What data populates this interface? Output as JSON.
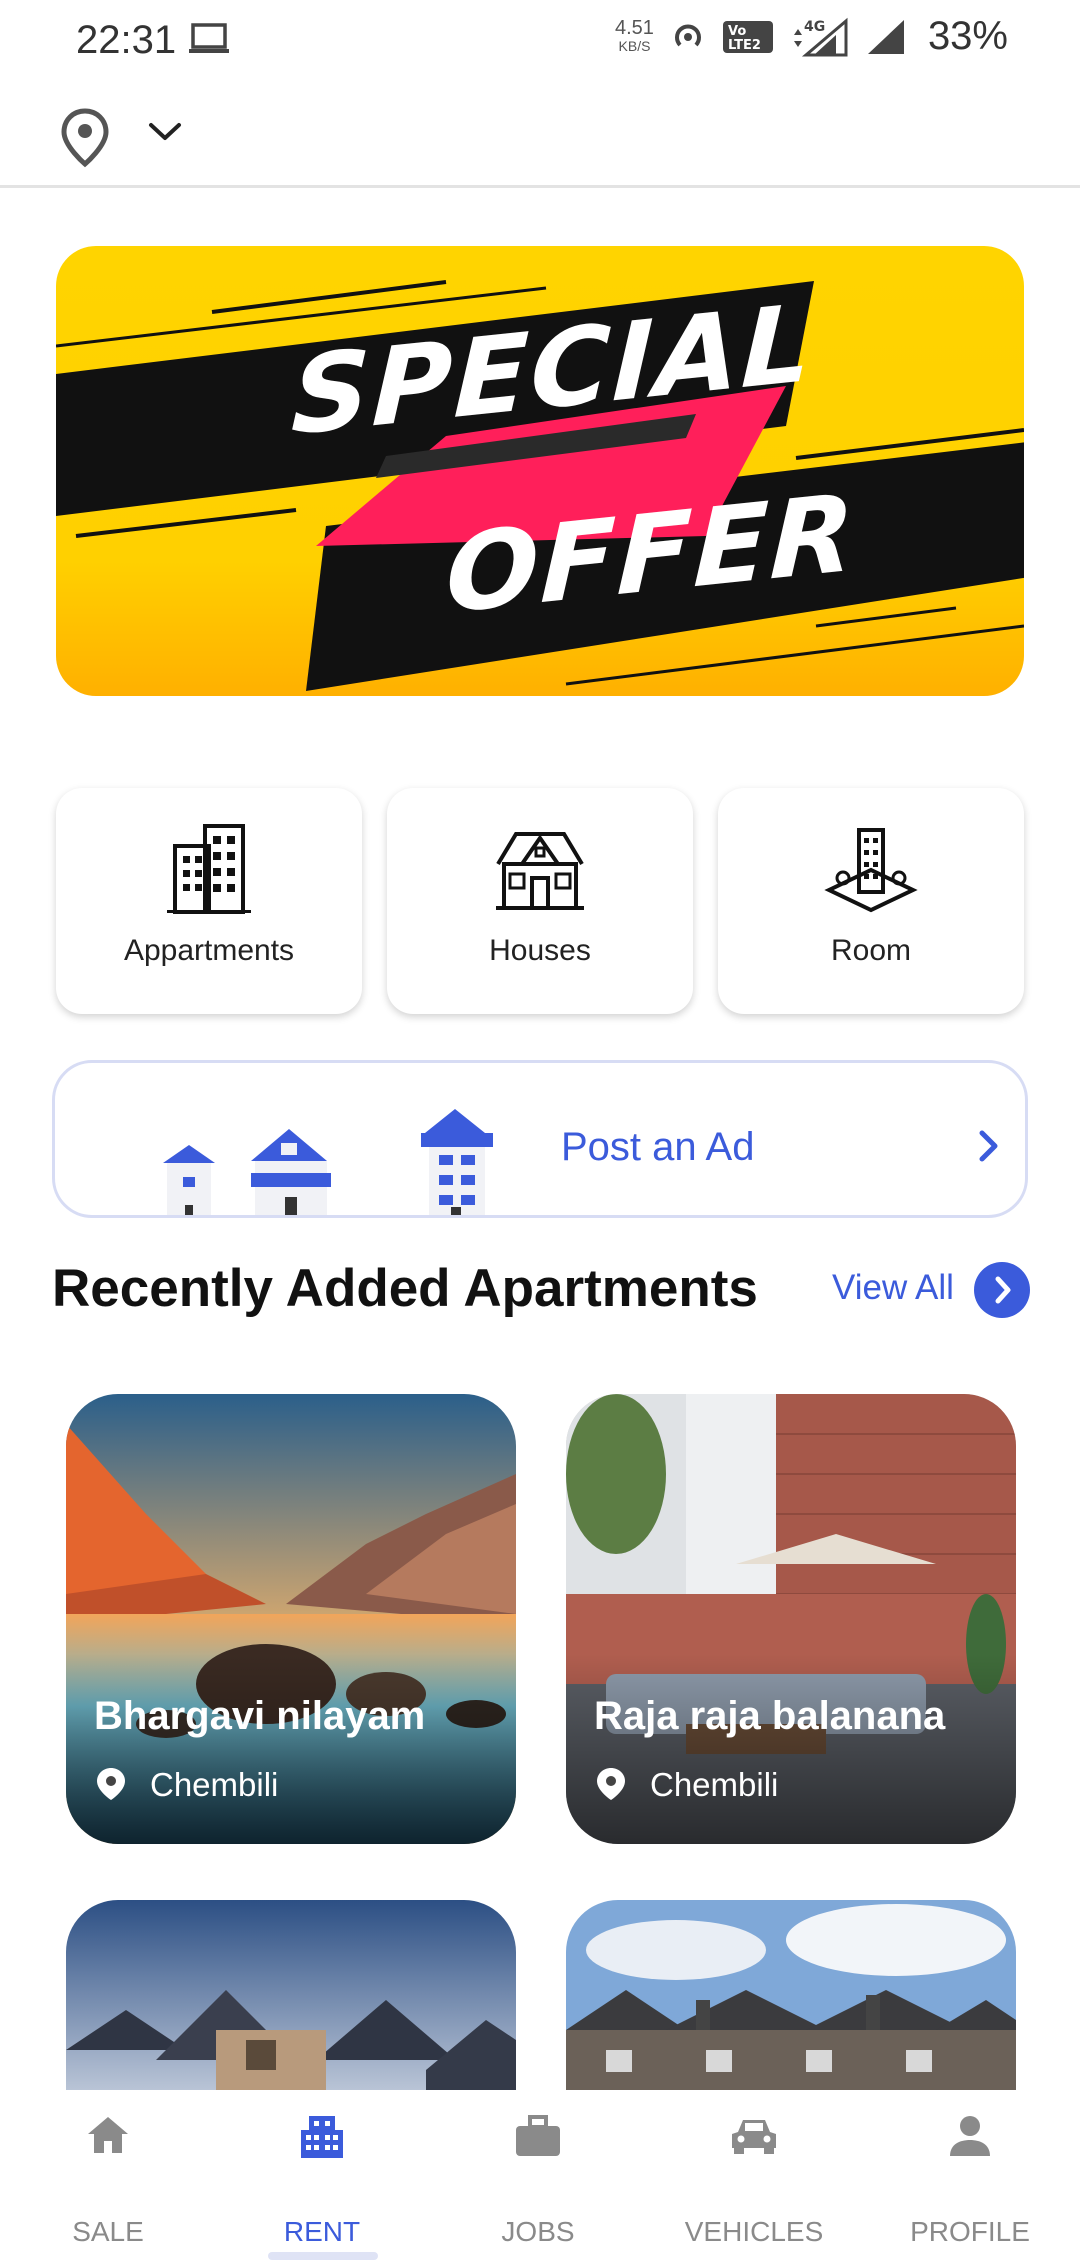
{
  "status_bar": {
    "time": "22:31",
    "speed_value": "4.51",
    "speed_unit": "KB/S",
    "network": "4G",
    "battery": "33%"
  },
  "top_bar": {
    "location_icon": "location-pin-icon",
    "dropdown_icon": "chevron-down-icon"
  },
  "banner": {
    "line1": "SPECIAL",
    "line2": "OFFER",
    "colors": {
      "background": "#ffd400",
      "stripe": "#111111",
      "accent": "#ff1f5a"
    }
  },
  "categories": [
    {
      "label": "Appartments",
      "icon": "apartment-building-icon"
    },
    {
      "label": "Houses",
      "icon": "house-icon"
    },
    {
      "label": "Room",
      "icon": "room-building-icon"
    }
  ],
  "post_ad": {
    "label": "Post an Ad",
    "icon": "chevron-right-icon"
  },
  "recent": {
    "title": "Recently Added Apartments",
    "view_all": "View All",
    "items": [
      {
        "name": "Bhargavi nilayam",
        "location": "Chembili"
      },
      {
        "name": "Raja raja balanana",
        "location": "Chembili"
      }
    ]
  },
  "bottom_nav": [
    {
      "label": "SALE",
      "icon": "home-icon",
      "active": false
    },
    {
      "label": "RENT",
      "icon": "building-icon",
      "active": true
    },
    {
      "label": "JOBS",
      "icon": "briefcase-icon",
      "active": false
    },
    {
      "label": "VEHICLES",
      "icon": "car-icon",
      "active": false
    },
    {
      "label": "PROFILE",
      "icon": "person-icon",
      "active": false
    }
  ],
  "colors": {
    "accent": "#3b5bdb",
    "inactive": "#8a8a8a"
  }
}
